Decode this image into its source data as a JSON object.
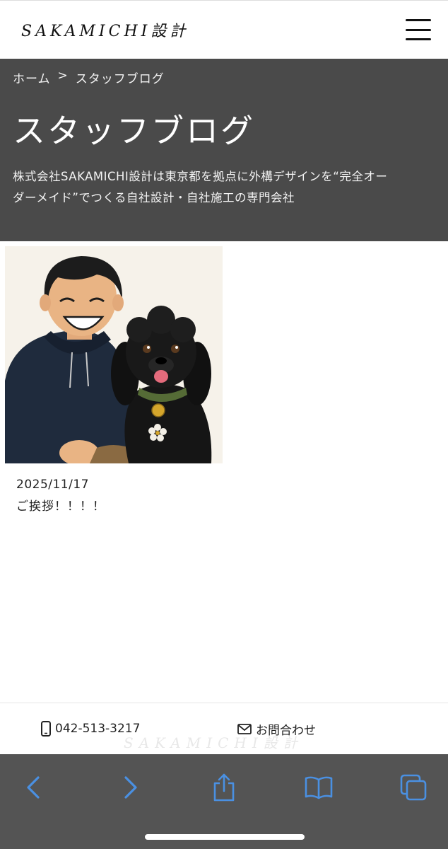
{
  "header": {
    "logo": "SAKAMICHI設計",
    "menu_icon": "hamburger-menu-icon"
  },
  "breadcrumb": {
    "home": "ホーム",
    "separator": ">",
    "current": "スタッフブログ"
  },
  "hero": {
    "title": "スタッフブログ",
    "description_line1": "株式会社SAKAMICHI設計は東京都を拠点に外構デザインを“完全オー",
    "description_line2": "ダーメイド”でつくる自社設計・自社施工の専門会社",
    "background": "#4a4a4a"
  },
  "posts": [
    {
      "date": "2025/11/17",
      "title": "ご挨拶！！！！",
      "thumbnail": "illustration-man-with-black-dog"
    }
  ],
  "contact": {
    "phone": "042-513-3217",
    "phone_icon": "phone-icon",
    "inquiry": "お問合わせ",
    "inquiry_icon": "mail-icon"
  },
  "browser": {
    "buttons": [
      "back-icon",
      "forward-icon",
      "share-icon",
      "bookmarks-icon",
      "tabs-icon"
    ],
    "accent": "#4a90e2"
  }
}
